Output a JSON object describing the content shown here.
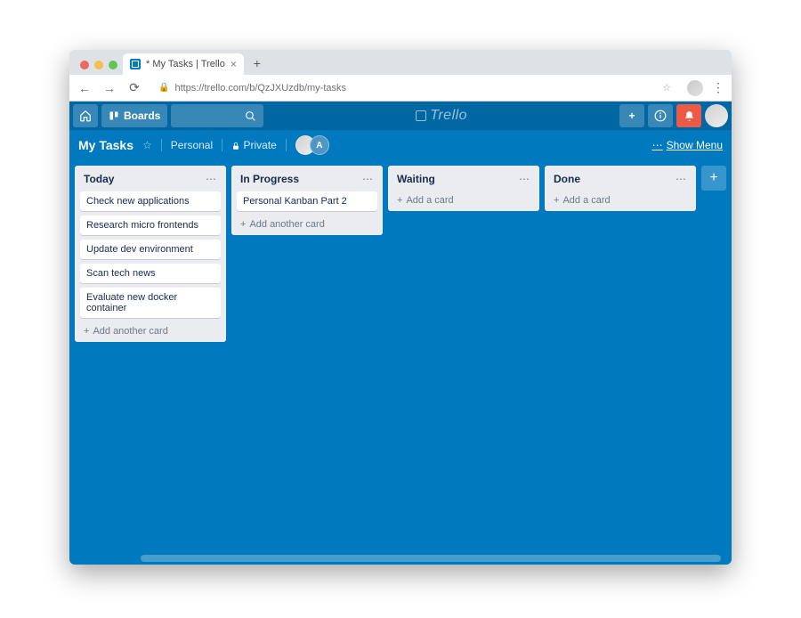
{
  "browser": {
    "tab_title": "* My Tasks | Trello",
    "url": "https://trello.com/b/QzJXUzdb/my-tasks"
  },
  "header": {
    "boards_button": "Boards",
    "logo_text": "Trello"
  },
  "board_bar": {
    "name": "My Tasks",
    "team": "Personal",
    "visibility": "Private",
    "member_initial": "A",
    "show_menu": "Show Menu"
  },
  "lists": [
    {
      "title": "Today",
      "cards": [
        "Check new applications",
        "Research micro frontends",
        "Update dev environment",
        "Scan tech news",
        "Evaluate new docker container"
      ],
      "add_label": "Add another card"
    },
    {
      "title": "In Progress",
      "cards": [
        "Personal Kanban Part 2"
      ],
      "add_label": "Add another card"
    },
    {
      "title": "Waiting",
      "cards": [],
      "add_label": "Add a card"
    },
    {
      "title": "Done",
      "cards": [],
      "add_label": "Add a card"
    }
  ]
}
